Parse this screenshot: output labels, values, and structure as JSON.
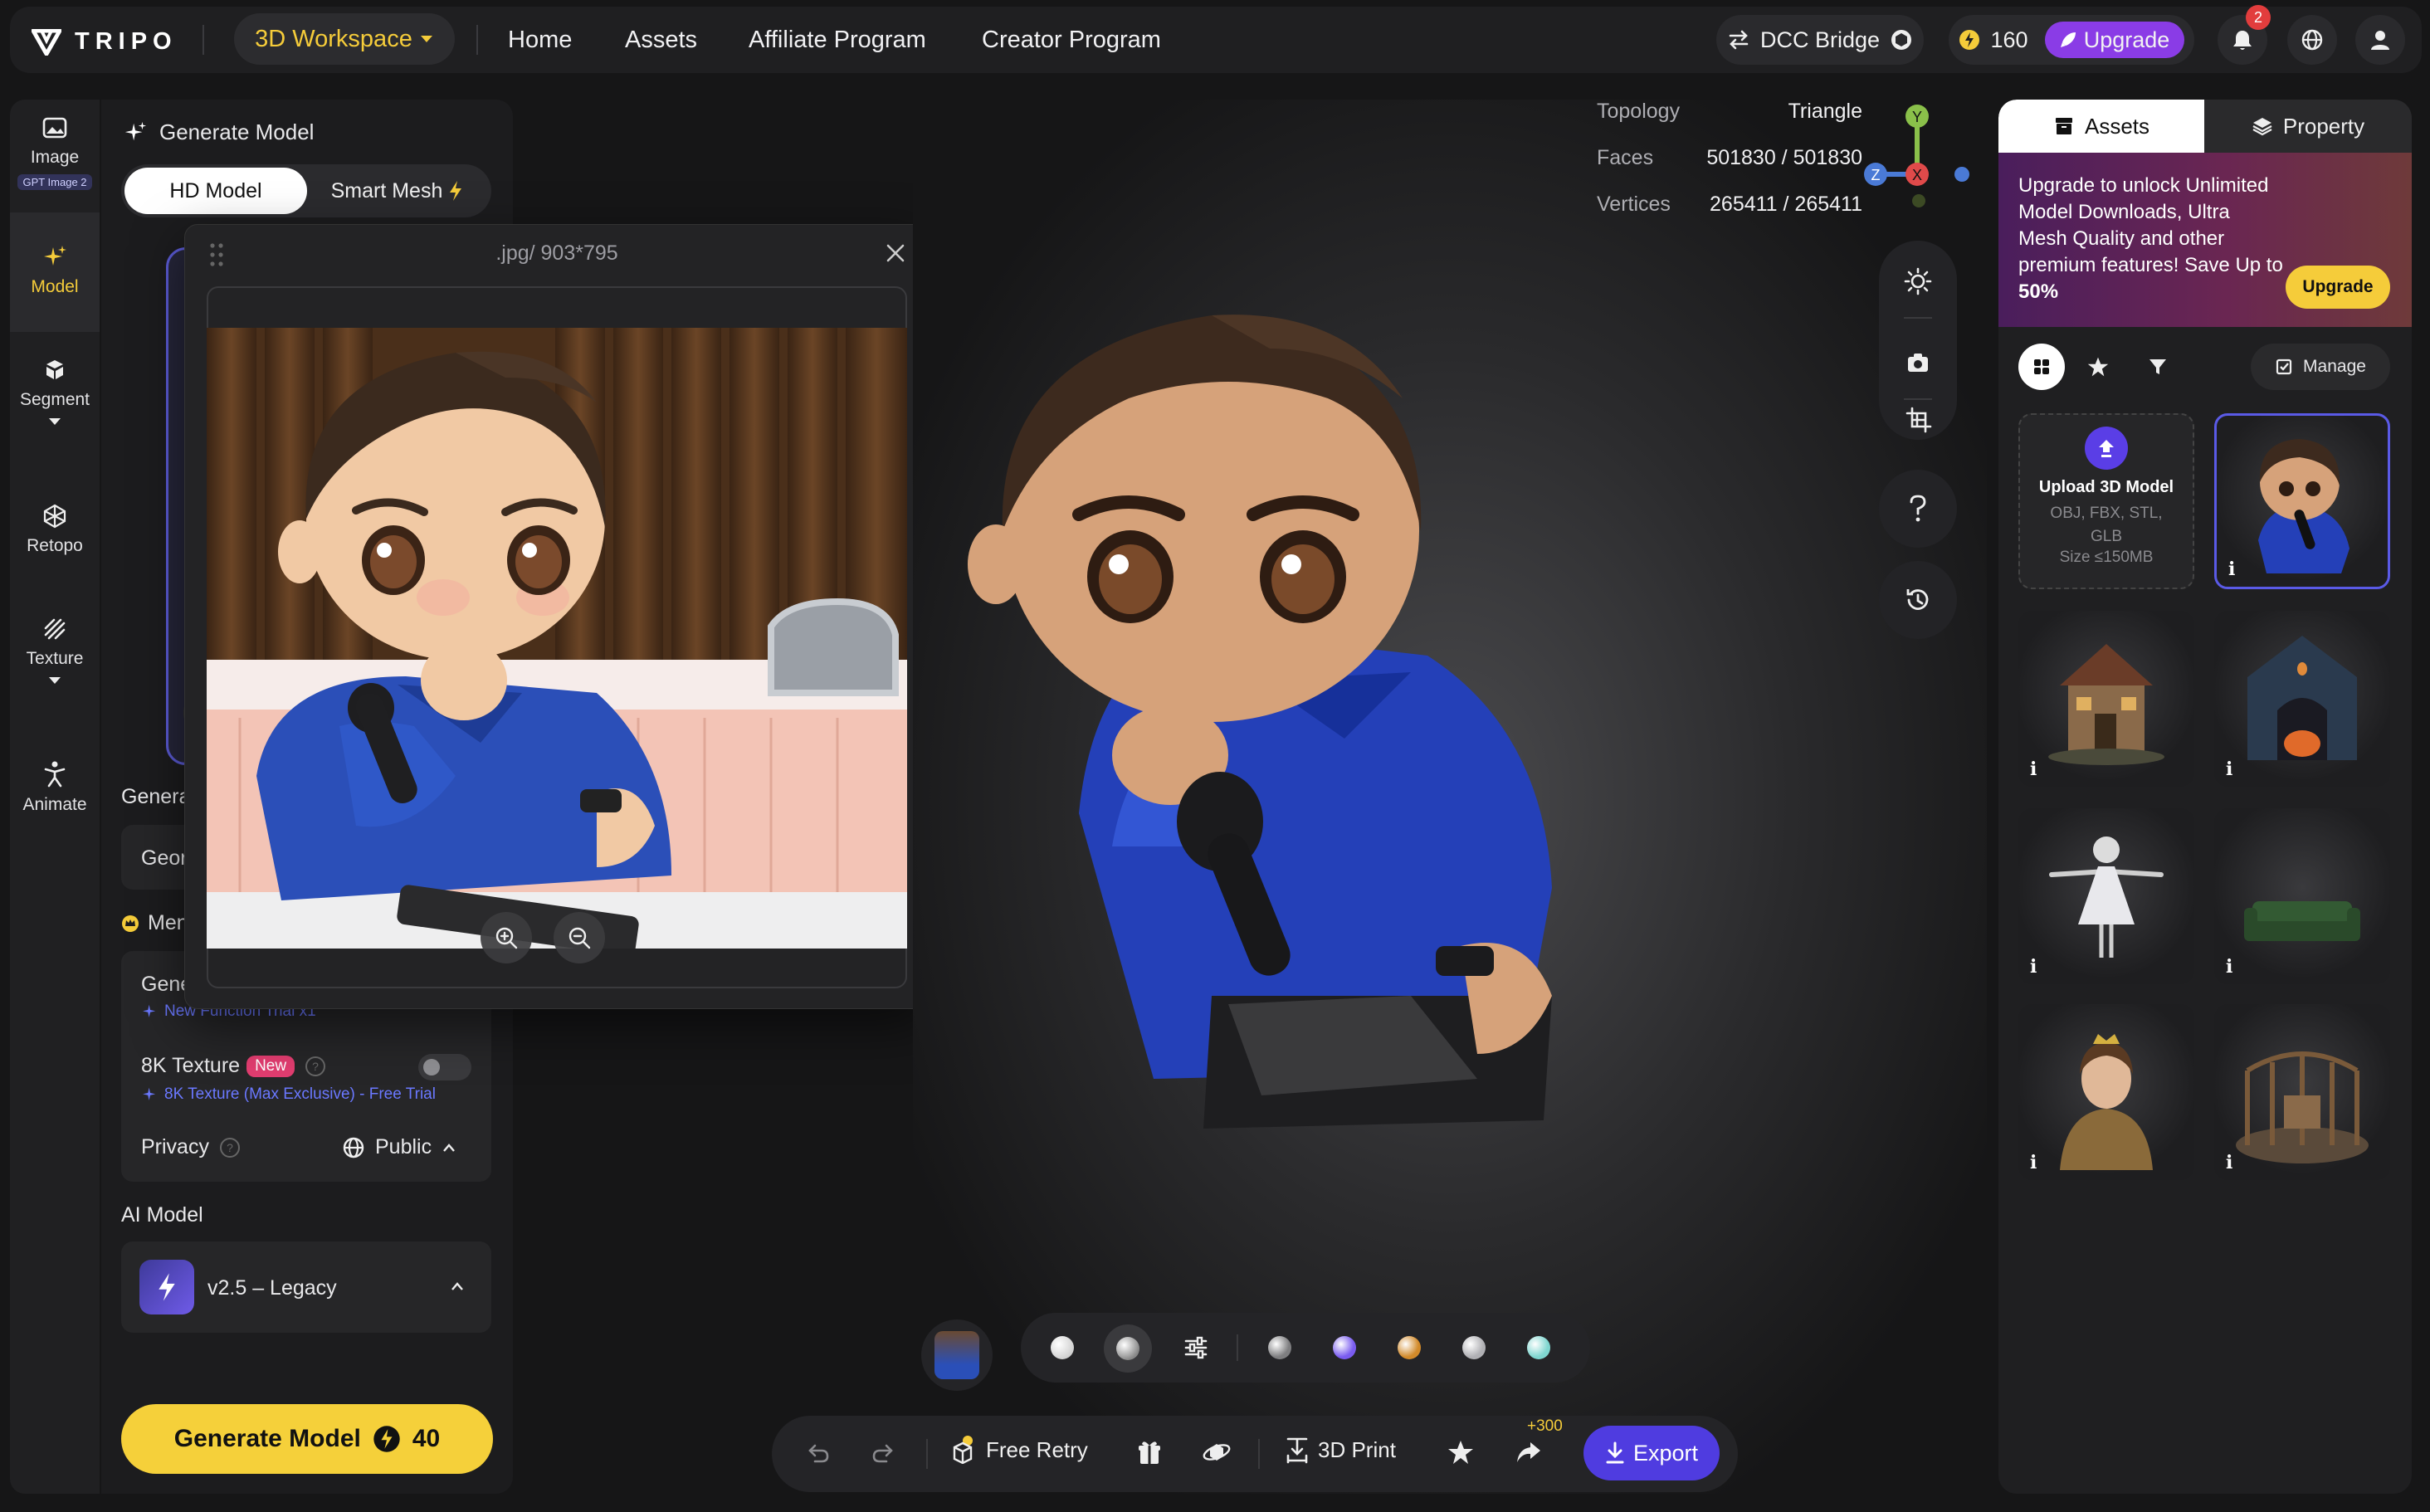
{
  "nav": {
    "logo_text": "TRIPO",
    "workspace_label": "3D Workspace",
    "links": [
      "Home",
      "Assets",
      "Affiliate Program",
      "Creator Program"
    ],
    "dcc_label": "DCC Bridge",
    "credits": "160",
    "upgrade_label": "Upgrade",
    "notification_count": "2"
  },
  "rail": {
    "image_label": "Image",
    "image_badge": "GPT Image 2",
    "model_label": "Model",
    "segment_label": "Segment",
    "retopo_label": "Retopo",
    "texture_label": "Texture",
    "animate_label": "Animate"
  },
  "panel": {
    "title": "Generate Model",
    "tab_hd": "HD Model",
    "tab_smart": "Smart Mesh",
    "generate_section_label": "Genera",
    "geometry_label": "Geor",
    "member_label": "Men",
    "gen_item_label": "Gene",
    "gen_item_sub": "New Function Trial x1",
    "texture8k_label": "8K Texture",
    "texture8k_badge": "New",
    "texture8k_sub": "8K Texture (Max Exclusive) - Free Trial",
    "privacy_label": "Privacy",
    "privacy_value": "Public",
    "ai_model_label": "AI Model",
    "ai_model_value": "v2.5 – Legacy",
    "generate_button": "Generate Model",
    "generate_cost": "40"
  },
  "popup": {
    "title": ".jpg/ 903*795"
  },
  "viewport": {
    "topology_label": "Topology",
    "topology_value": "Triangle",
    "faces_label": "Faces",
    "faces_value": "501830 / 501830",
    "vertices_label": "Vertices",
    "vertices_value": "265411 / 265411",
    "axis_y": "Y",
    "axis_z": "Z",
    "axis_x": "X"
  },
  "actions": {
    "free_retry": "Free Retry",
    "print": "3D Print",
    "share_bonus": "+300",
    "export": "Export"
  },
  "materials": {
    "swatch_colors": [
      "#d8d8d8",
      "#7e7e80",
      "#7a5cf0",
      "#d28a2a",
      "#b0b0b4",
      "#7fd6d0"
    ]
  },
  "right": {
    "tab_assets": "Assets",
    "tab_property": "Property",
    "promo_text": "Upgrade to unlock Unlimited Model Downloads, Ultra Mesh Quality and other premium features!  Save Up to ",
    "promo_percent": "50%",
    "promo_button": "Upgrade",
    "manage_label": "Manage",
    "upload_title": "Upload 3D Model",
    "upload_formats": "OBJ, FBX, STL, GLB",
    "upload_size": "Size ≤150MB",
    "info_glyph": "i"
  },
  "colors": {
    "accent_yellow": "#f5cc3a",
    "accent_purple": "#5a3ee6",
    "link_blue": "#6a78ff"
  }
}
